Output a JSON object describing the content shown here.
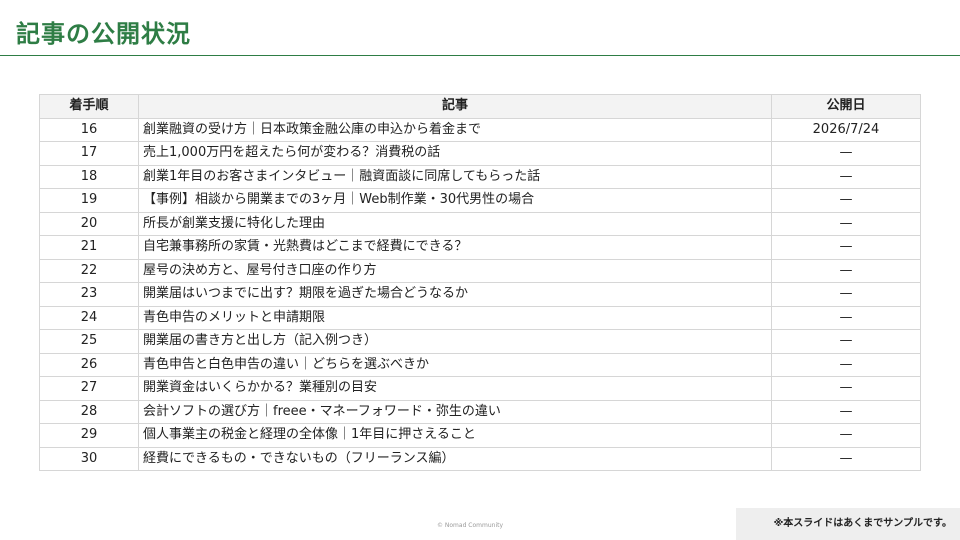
{
  "page": {
    "title": "記事の公開状況",
    "accent_color": "#2e7d45"
  },
  "table": {
    "headers": {
      "order": "着手順",
      "article": "記事",
      "date": "公開日"
    },
    "rows": [
      {
        "order": "16",
        "article": "創業融資の受け方｜日本政策金融公庫の申込から着金まで",
        "date": "2026/7/24"
      },
      {
        "order": "17",
        "article": "売上1,000万円を超えたら何が変わる？消費税の話",
        "date": "—"
      },
      {
        "order": "18",
        "article": "創業1年目のお客さまインタビュー｜融資面談に同席してもらった話",
        "date": "—"
      },
      {
        "order": "19",
        "article": "【事例】相談から開業までの3ヶ月｜Web制作業・30代男性の場合",
        "date": "—"
      },
      {
        "order": "20",
        "article": "所長が創業支援に特化した理由",
        "date": "—"
      },
      {
        "order": "21",
        "article": "自宅兼事務所の家賃・光熱費はどこまで経費にできる？",
        "date": "—"
      },
      {
        "order": "22",
        "article": "屋号の決め方と、屋号付き口座の作り方",
        "date": "—"
      },
      {
        "order": "23",
        "article": "開業届はいつまでに出す？期限を過ぎた場合どうなるか",
        "date": "—"
      },
      {
        "order": "24",
        "article": "青色申告のメリットと申請期限",
        "date": "—"
      },
      {
        "order": "25",
        "article": "開業届の書き方と出し方（記入例つき）",
        "date": "—"
      },
      {
        "order": "26",
        "article": "青色申告と白色申告の違い｜どちらを選ぶべきか",
        "date": "—"
      },
      {
        "order": "27",
        "article": "開業資金はいくらかかる？業種別の目安",
        "date": "—"
      },
      {
        "order": "28",
        "article": "会計ソフトの選び方｜freee・マネーフォワード・弥生の違い",
        "date": "—"
      },
      {
        "order": "29",
        "article": "個人事業主の税金と経理の全体像｜1年目に押さえること",
        "date": "—"
      },
      {
        "order": "30",
        "article": "経費にできるもの・できないもの（フリーランス編）",
        "date": "—"
      }
    ]
  },
  "footer": {
    "copyright": "© Nomad Community",
    "sample_note": "※本スライドはあくまでサンプルです。"
  }
}
